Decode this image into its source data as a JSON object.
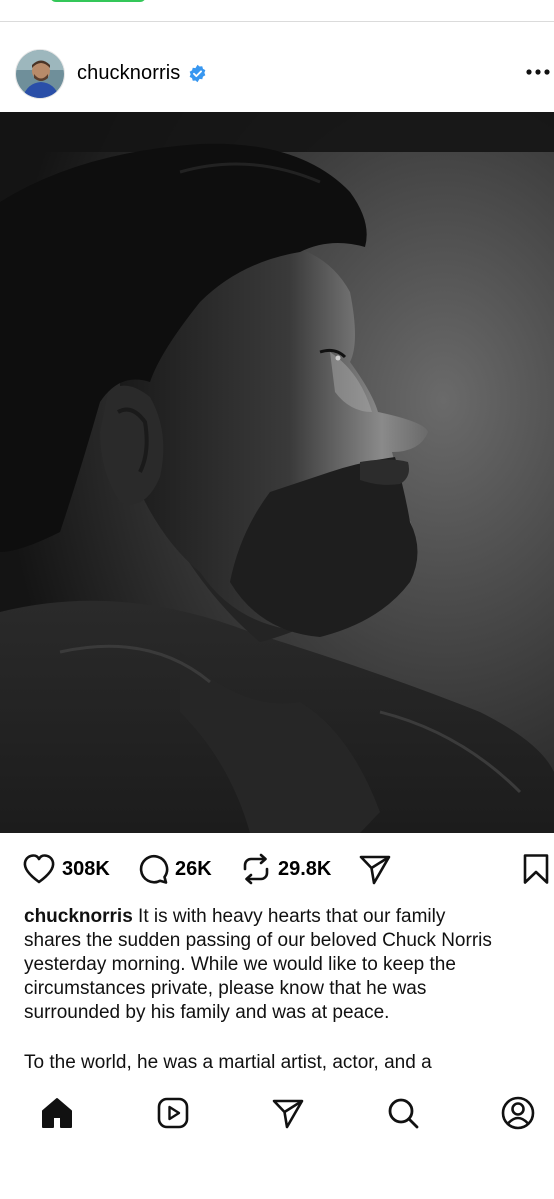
{
  "post": {
    "username": "chucknorris",
    "verified": true,
    "likes": "308K",
    "comments": "26K",
    "reposts": "29.8K",
    "caption_lines": [
      "It is with heavy hearts that our family",
      "shares the sudden passing of our beloved Chuck Norris",
      "yesterday morning. While we would like to keep the",
      "circumstances private, please know that he was",
      "surrounded by his family and was at peace."
    ],
    "caption_line2": "To the world, he was a martial artist, actor, and a"
  },
  "colors": {
    "verified_blue": "#3897f0",
    "status_green": "#34c759",
    "divider": "#dbdbdb"
  },
  "icons": {
    "header": [
      "verified-badge-icon",
      "more-options-icon"
    ],
    "actions": [
      "heart-icon",
      "comment-icon",
      "repost-icon",
      "share-icon",
      "bookmark-icon"
    ],
    "nav": [
      "home-icon",
      "reels-icon",
      "send-icon",
      "search-icon",
      "profile-icon"
    ]
  }
}
